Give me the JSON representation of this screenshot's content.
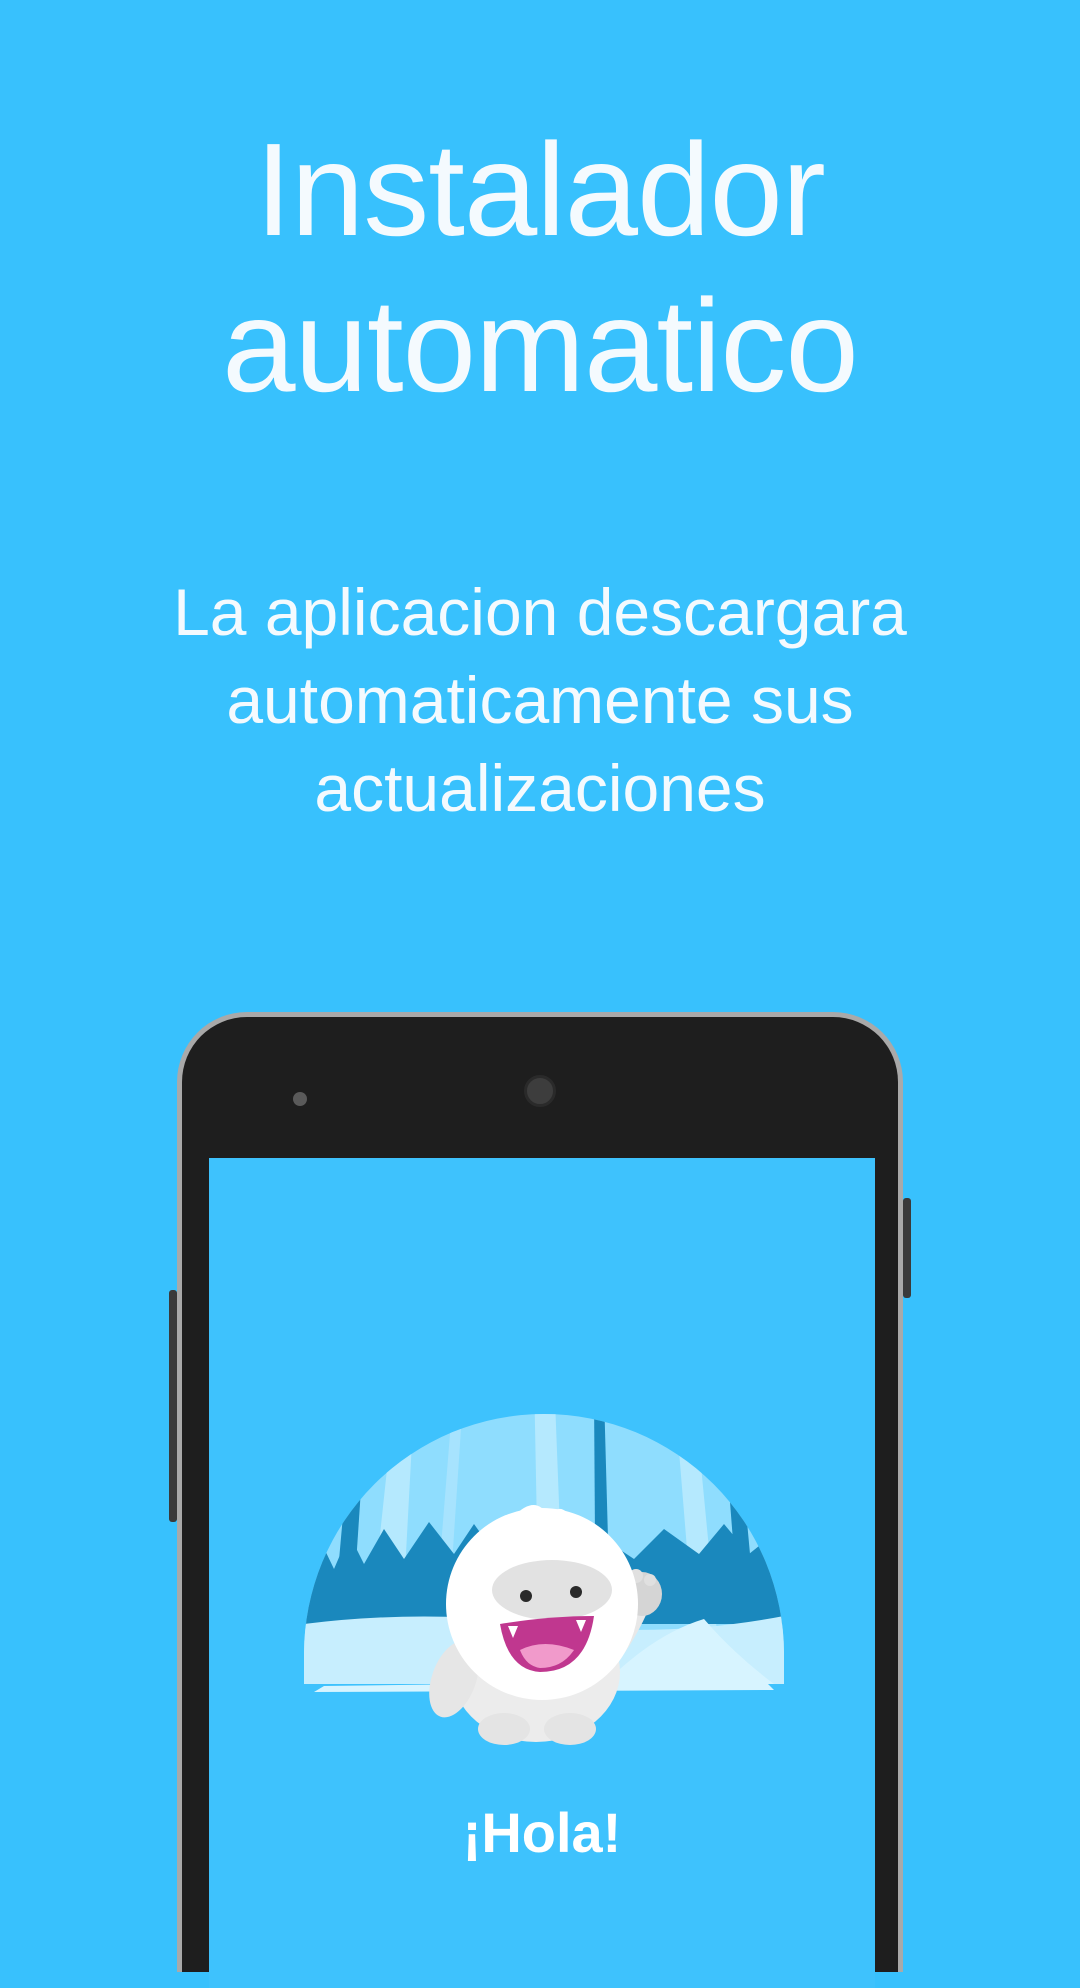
{
  "header": {
    "title_line1": "Instalador",
    "title_line2": "automatico"
  },
  "description": {
    "line1": "La aplicacion descargara",
    "line2": "automaticamente sus",
    "line3": "actualizaciones"
  },
  "phone_screen": {
    "greeting": "¡Hola!"
  },
  "colors": {
    "background": "#38C1FD",
    "text": "#F4FAFE",
    "phone_body": "#1E1E1E",
    "phone_frame": "#A9A9A9"
  }
}
